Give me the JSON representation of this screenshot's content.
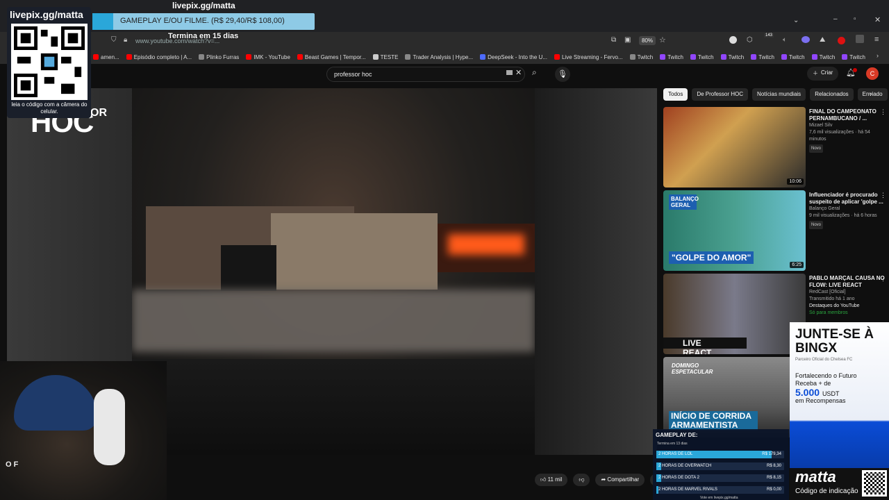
{
  "stream": {
    "livepix_handle": "livepix.gg/matta",
    "qr_caption": "leia o código com a câmera do celular.",
    "goal_text": "GAMEPLAY E/OU FILME. (R$ 29,40/R$ 108,00)",
    "goal_fraction": 0.27,
    "goal_timer": "Termina em 15 dias"
  },
  "browser": {
    "url": "www.youtube.com/watch?v=...",
    "zoom": "80%",
    "badge_count": "143",
    "bookmarks": [
      {
        "label": "amen...",
        "icon": "youtube-icon",
        "color": "#ff0000"
      },
      {
        "label": "Episódio completo | A...",
        "icon": "youtube-icon",
        "color": "#ff0000"
      },
      {
        "label": "Plinko Furras",
        "icon": "globe-icon",
        "color": "#888888"
      },
      {
        "label": "IMK - YouTube",
        "icon": "youtube-icon",
        "color": "#ff0000"
      },
      {
        "label": "Beast Games | Tempor...",
        "icon": "youtube-icon",
        "color": "#ff0000"
      },
      {
        "label": "TESTE",
        "icon": "folder-icon",
        "color": "#cccccc"
      },
      {
        "label": "Trader Analysis | Hype...",
        "icon": "globe-icon",
        "color": "#888888"
      },
      {
        "label": "DeepSeek - Into the U...",
        "icon": "deepseek-icon",
        "color": "#4d6bfe"
      },
      {
        "label": "Live Streaming - Fervo...",
        "icon": "youtube-icon",
        "color": "#ff0000"
      },
      {
        "label": "Twitch",
        "icon": "globe-icon",
        "color": "#888888"
      },
      {
        "label": "Twitch",
        "icon": "twitch-icon",
        "color": "#9146ff"
      },
      {
        "label": "Twitch",
        "icon": "twitch-icon",
        "color": "#9146ff"
      },
      {
        "label": "Twitch",
        "icon": "twitch-icon",
        "color": "#9146ff"
      },
      {
        "label": "Twitch",
        "icon": "twitch-icon",
        "color": "#9146ff"
      },
      {
        "label": "Twitch",
        "icon": "twitch-icon",
        "color": "#9146ff"
      },
      {
        "label": "Twitch",
        "icon": "twitch-icon",
        "color": "#9146ff"
      },
      {
        "label": "Twitch",
        "icon": "twitch-icon",
        "color": "#9146ff"
      }
    ]
  },
  "youtube": {
    "search_value": "professor hoc",
    "create_label": "Criar",
    "avatar_letter": "C",
    "channel_brand": "HOC",
    "channel_brand_partial": "OR",
    "likes": "11 mil",
    "share_label": "Compartilhar",
    "chips": [
      "Todos",
      "De Professor HOC",
      "Notícias mundiais",
      "Relacionados",
      "Enviado"
    ],
    "recommendations": [
      {
        "title": "FINAL DO CAMPEONATO PERNAMBUCANO / ...",
        "channel": "Mizael Silv",
        "meta": "7,6 mil visualizações · há 54 minutos",
        "badge": "Novo",
        "duration": "10:06"
      },
      {
        "title": "Influenciador é procurado suspeito de aplicar 'golpe ...",
        "channel": "Balanço Geral",
        "meta": "9 mil visualizações · há 6 horas",
        "badge": "Novo",
        "duration": "6:25",
        "thumb_caption": "\"GOLPE DO AMOR\"",
        "thumb_tag": "BALANÇO GERAL"
      },
      {
        "title": "PABLO MARÇAL CAUSA NO FLOW: LIVE REACT",
        "channel": "RedCast [Oficial]",
        "meta": "Transmitido há 1 ano",
        "badge": "Destaques do YouTube",
        "badge2": "Só para membros",
        "thumb_caption": "LIVE REACT"
      },
      {
        "title": "",
        "channel": "",
        "meta": "",
        "thumb_tag": "DOMINGO ESPETACULAR",
        "thumb_caption": "INÍCIO DE CORRIDA ARMAMENTISTA"
      }
    ]
  },
  "bingx_ad": {
    "headline": "JUNTE-SE À BINGX",
    "subline": "Parceiro Oficial do Chelsea FC",
    "body1": "Fortalecendo o Futuro",
    "body2": "Receba + de",
    "amount": "5.000",
    "currency": "USDT",
    "body3": "em Recompensas",
    "code_brand": "matta",
    "code_label": "Código de indicação"
  },
  "gameplay_poll": {
    "title": "GAMEPLAY DE:",
    "timer": "Termina em 13 dias",
    "footer": "Vote em livepix.gg/matta",
    "options": [
      {
        "label": "2 HORAS DE LOL",
        "value": "R$ 179,34",
        "fraction": 0.9
      },
      {
        "label": "2 HORAS DE OVERWATCH",
        "value": "R$ 8,30",
        "fraction": 0.04
      },
      {
        "label": "2 HORAS DE DOTA 2",
        "value": "R$ 8,15",
        "fraction": 0.04
      },
      {
        "label": "2 HORAS DE MARVEL RIVALS",
        "value": "R$ 0,00",
        "fraction": 0
      }
    ]
  },
  "webcam_text": "O F"
}
